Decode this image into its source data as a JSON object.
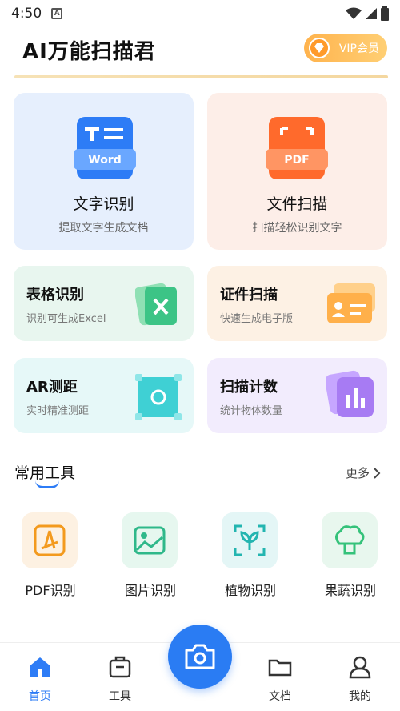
{
  "status_bar": {
    "time": "4:50",
    "notif_letter": "A"
  },
  "header": {
    "title": "AI万能扫描君",
    "vip_label": "VIP会员"
  },
  "big_cards": [
    {
      "title": "文字识别",
      "subtitle": "提取文字生成文档",
      "badge": "Word",
      "color": "#e6effd"
    },
    {
      "title": "文件扫描",
      "subtitle": "扫描轻松识别文字",
      "badge": "PDF",
      "color": "#fdeee8"
    }
  ],
  "small_cards": [
    {
      "title": "表格识别",
      "subtitle": "识别可生成Excel",
      "color": "#e8f6ef"
    },
    {
      "title": "证件扫描",
      "subtitle": "快速生成电子版",
      "color": "#fdf1e4"
    },
    {
      "title": "AR测距",
      "subtitle": "实时精准测距",
      "color": "#e6f8f8"
    },
    {
      "title": "扫描计数",
      "subtitle": "统计物体数量",
      "color": "#f2ecfd"
    }
  ],
  "tools_section": {
    "title": "常用工具",
    "more": "更多"
  },
  "tools": [
    {
      "label": "PDF识别",
      "icon": "pdf-icon",
      "bg": "#fdf1e2"
    },
    {
      "label": "图片识别",
      "icon": "image-icon",
      "bg": "#e6f7ef"
    },
    {
      "label": "植物识别",
      "icon": "plant-icon",
      "bg": "#e4f6f6"
    },
    {
      "label": "果蔬识别",
      "icon": "vegetable-icon",
      "bg": "#e8f7ee"
    }
  ],
  "bottom_nav": {
    "items": [
      {
        "label": "首页",
        "icon": "home-icon",
        "active": true
      },
      {
        "label": "工具",
        "icon": "toolbox-icon",
        "active": false
      },
      {
        "label": "文档",
        "icon": "folder-icon",
        "active": false
      },
      {
        "label": "我的",
        "icon": "user-icon",
        "active": false
      }
    ],
    "camera_icon": "camera-icon"
  },
  "colors": {
    "accent": "#2d7cf6",
    "vip_orange": "#ffb34d"
  }
}
